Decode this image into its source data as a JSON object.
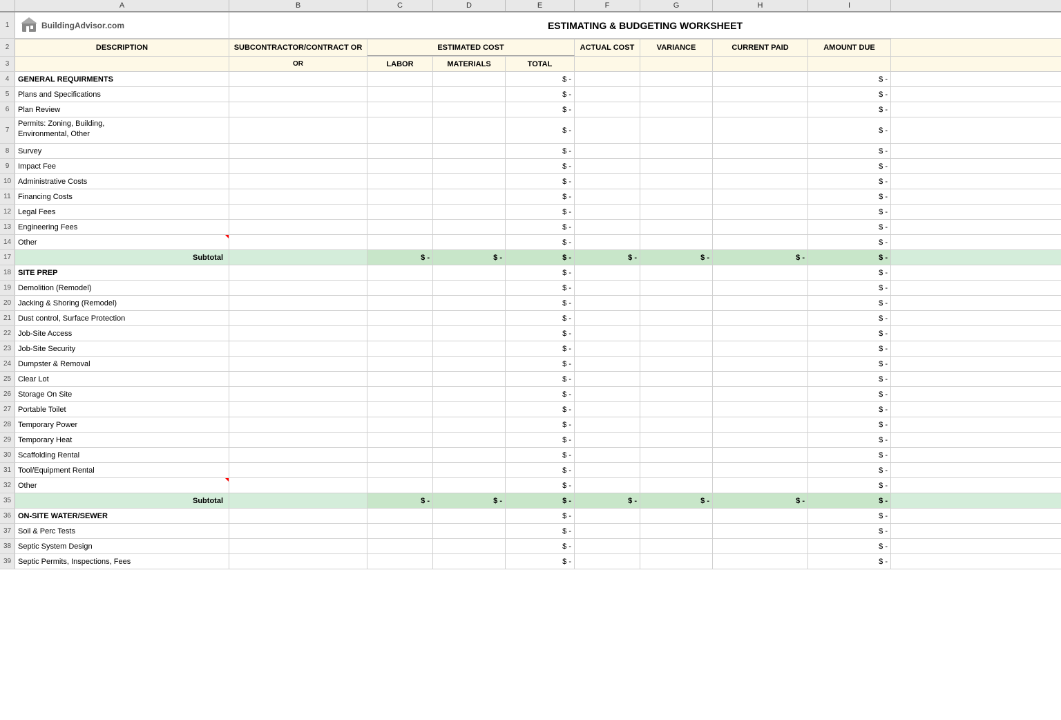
{
  "title": "ESTIMATING & BUDGETING WORKSHEET",
  "logo": "BuildingAdvisor.com",
  "columns": {
    "idx": "#",
    "a": "A",
    "b": "B",
    "c": "C",
    "d": "D",
    "e": "E",
    "f": "F",
    "g": "G",
    "h": "H",
    "i": "I"
  },
  "headers": {
    "row2": {
      "description": "DESCRIPTION",
      "subcontractor": "SUBCONTRACTOR/CONTRACT OR",
      "estimated_cost": "ESTIMATED COST",
      "actual_cost": "ACTUAL COST",
      "variance": "VARIANCE",
      "current_paid": "CURRENT PAID",
      "amount_due": "AMOUNT DUE"
    },
    "row3": {
      "labor": "LABOR",
      "materials": "MATERIALS",
      "total": "TOTAL"
    }
  },
  "rows": [
    {
      "num": "4",
      "label": "GENERAL REQUIRMENTS",
      "bold": true,
      "total": "$ -",
      "amount_due": "$ -"
    },
    {
      "num": "5",
      "label": "Plans and Specifications",
      "total": "$ -",
      "amount_due": "$ -"
    },
    {
      "num": "6",
      "label": "Plan Review",
      "total": "$ -",
      "amount_due": "$ -"
    },
    {
      "num": "7",
      "label": "Permits: Zoning, Building,\nEnvironmental, Other",
      "total": "$ -",
      "amount_due": "$ -",
      "tall": true
    },
    {
      "num": "8",
      "label": "Survey",
      "total": "$ -",
      "amount_due": "$ -"
    },
    {
      "num": "9",
      "label": "Impact Fee",
      "total": "$ -",
      "amount_due": "$ -"
    },
    {
      "num": "10",
      "label": "Administrative Costs",
      "total": "$ -",
      "amount_due": "$ -"
    },
    {
      "num": "11",
      "label": "Financing Costs",
      "total": "$ -",
      "amount_due": "$ -"
    },
    {
      "num": "12",
      "label": "Legal Fees",
      "total": "$ -",
      "amount_due": "$ -"
    },
    {
      "num": "13",
      "label": "Engineering Fees",
      "total": "$ -",
      "amount_due": "$ -"
    },
    {
      "num": "14",
      "label": "Other",
      "total": "$ -",
      "amount_due": "$ -",
      "triangle": true
    },
    {
      "num": "17",
      "label": "Subtotal",
      "subtotal": true,
      "labor": "$ -",
      "materials": "$ -",
      "total": "$ -",
      "actual": "$ -",
      "variance": "$ -",
      "current_paid": "$ -",
      "amount_due": "$ -"
    },
    {
      "num": "18",
      "label": "SITE PREP",
      "bold": true,
      "total": "$ -",
      "amount_due": "$ -"
    },
    {
      "num": "19",
      "label": "Demolition (Remodel)",
      "total": "$ -",
      "amount_due": "$ -"
    },
    {
      "num": "20",
      "label": "Jacking & Shoring (Remodel)",
      "total": "$ -",
      "amount_due": "$ -"
    },
    {
      "num": "21",
      "label": "Dust control, Surface Protection",
      "total": "$ -",
      "amount_due": "$ -"
    },
    {
      "num": "22",
      "label": "Job-Site Access",
      "total": "$ -",
      "amount_due": "$ -"
    },
    {
      "num": "23",
      "label": "Job-Site Security",
      "total": "$ -",
      "amount_due": "$ -"
    },
    {
      "num": "24",
      "label": "Dumpster & Removal",
      "total": "$ -",
      "amount_due": "$ -"
    },
    {
      "num": "25",
      "label": "Clear Lot",
      "total": "$ -",
      "amount_due": "$ -"
    },
    {
      "num": "26",
      "label": "Storage On Site",
      "total": "$ -",
      "amount_due": "$ -"
    },
    {
      "num": "27",
      "label": "Portable Toilet",
      "total": "$ -",
      "amount_due": "$ -"
    },
    {
      "num": "28",
      "label": "Temporary Power",
      "total": "$ -",
      "amount_due": "$ -"
    },
    {
      "num": "29",
      "label": "Temporary Heat",
      "total": "$ -",
      "amount_due": "$ -"
    },
    {
      "num": "30",
      "label": "Scaffolding Rental",
      "total": "$ -",
      "amount_due": "$ -"
    },
    {
      "num": "31",
      "label": "Tool/Equipment Rental",
      "total": "$ -",
      "amount_due": "$ -"
    },
    {
      "num": "32",
      "label": "Other",
      "total": "$ -",
      "amount_due": "$ -",
      "triangle": true
    },
    {
      "num": "35",
      "label": "Subtotal",
      "subtotal": true,
      "labor": "$ -",
      "materials": "$ -",
      "total": "$ -",
      "actual": "$ -",
      "variance": "$ -",
      "current_paid": "$ -",
      "amount_due": "$ -"
    },
    {
      "num": "36",
      "label": "ON-SITE WATER/SEWER",
      "bold": true,
      "total": "$ -",
      "amount_due": "$ -"
    },
    {
      "num": "37",
      "label": "Soil & Perc Tests",
      "total": "$ -",
      "amount_due": "$ -"
    },
    {
      "num": "38",
      "label": "Septic System Design",
      "total": "$ -",
      "amount_due": "$ -"
    },
    {
      "num": "39",
      "label": "Septic Permits, Inspections, Fees",
      "total": "$ -",
      "amount_due": "$ -"
    }
  ]
}
